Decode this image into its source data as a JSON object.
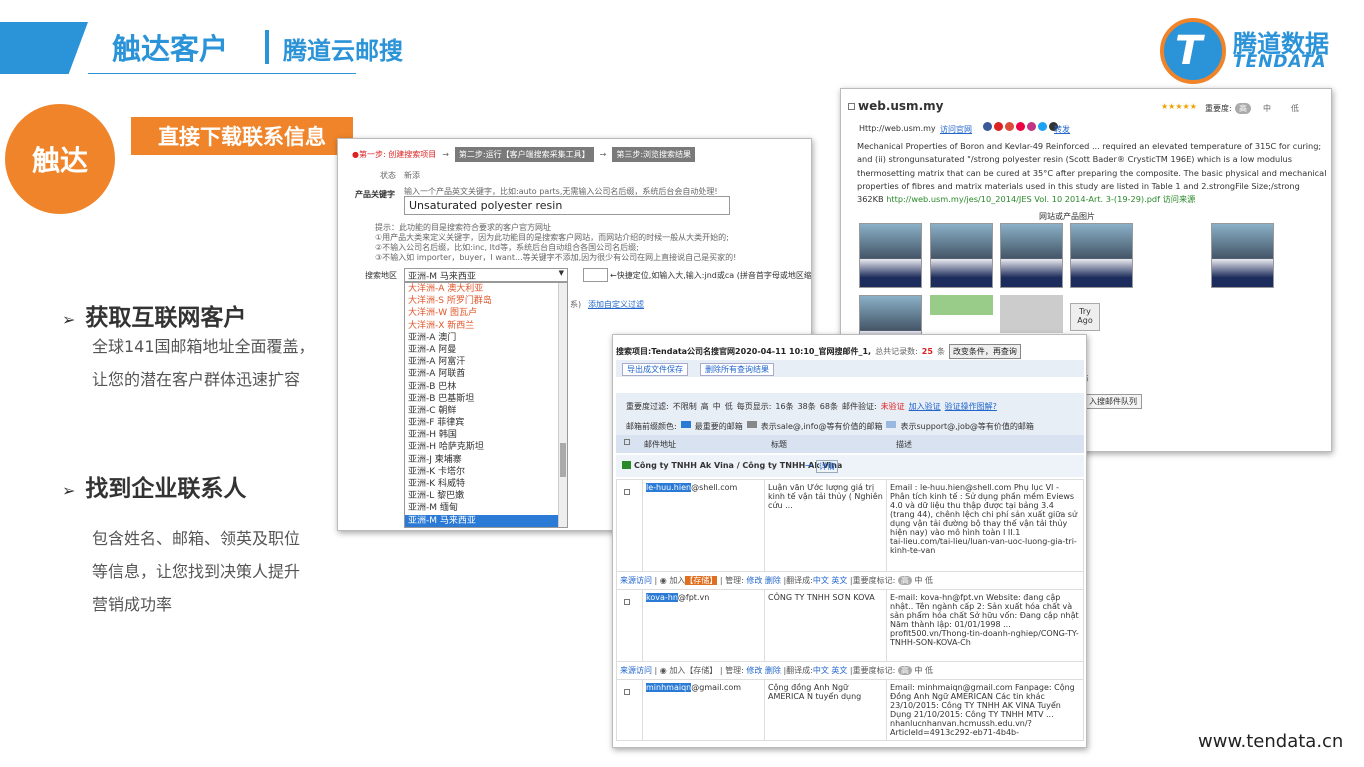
{
  "header": {
    "title": "触达客户",
    "separator": "|",
    "subtitle": "腾道云邮搜"
  },
  "logo": {
    "cn": "腾道数据",
    "en": "TENDATA"
  },
  "left": {
    "circle": "触达",
    "tag": "直接下载联系信息",
    "b1": "获取互联网客户",
    "d1": "全球141国邮箱地址全面覆盖， 让您的潜在客户群体迅速扩容",
    "b2": "找到企业联系人",
    "d2": "包含姓名、邮箱、领英及职位等信息，让您找到决策人提升营销成功率"
  },
  "footer_url": "www.tendata.cn",
  "search": {
    "step1": "●第一步: 创建搜索项目",
    "step2": "第二步:运行【客户端搜索采集工具】",
    "step3": "第三步:浏览搜索结果",
    "arrow": "→",
    "status_label": "状态",
    "status_value": "新添",
    "kw_label": "产品关键字",
    "kw_hint": "输入一个产品英文关键字，比如:auto parts,无需输入公司名后缀，系统后台会自动处理!",
    "kw_value": "Unsaturated polyester resin",
    "tips": [
      "提示：此功能的目是搜索符合要求的客户官方网址",
      "①用产品大类来定义关键字，因为此功能目的是搜索客户网站，而网站介绍的时候一般从大类开始的;",
      "②不输入公司名后缀，比如:inc, ltd等，系统后台自动组合各国公司名后缀;",
      "③不输入如 importer，buyer，I want...等关键字不添加,因为很少有公司在网上直接说自己是买家的!"
    ],
    "region_label": "搜索地区",
    "region_value": "亚洲-M 马来西亚",
    "locate_hint": "←快捷定位,如输入大,输入:jnd或ca (拼音首字母或地区缩写)",
    "add_custom": "添加自定义过滤",
    "addbefore": "系)",
    "options": [
      "大洋洲-A 澳大利亚",
      "大洋洲-S 所罗门群岛",
      "大洋洲-W 图瓦卢",
      "大洋洲-X 新西兰",
      "亚洲-A 澳门",
      "亚洲-A 阿曼",
      "亚洲-A 阿富汗",
      "亚洲-A 阿联酋",
      "亚洲-B 巴林",
      "亚洲-B 巴基斯坦",
      "亚洲-C 朝鲜",
      "亚洲-F 菲律宾",
      "亚洲-H 韩国",
      "亚洲-H 哈萨克斯坦",
      "亚洲-J 柬埔寨",
      "亚洲-K 卡塔尔",
      "亚洲-K 科威特",
      "亚洲-L 黎巴嫩",
      "亚洲-M 缅甸",
      "亚洲-M 马来西亚"
    ]
  },
  "web": {
    "domain": "web.usm.my",
    "importance": "重要度:",
    "imp_opts": [
      "高",
      "中",
      "低"
    ],
    "http": "Http://web.usm.my",
    "visit": "访问官网",
    "forward": "转发",
    "body": "Mechanical Properties of Boron and Kevlar-49 Reinforced ... required an elevated temperature of 315C for curing; and (ii) strongunsaturated \"/strong polyester resin (Scott Bader® CrysticTM 196E) which is a low modulus thermosetting matrix that can be cured at 35°C after preparing the composite. The basic physical and mechanical properties of fibres and matrix materials used in this study are listed in Table 1 and 2.strongFile Size;/strong 362KB",
    "link": "http://web.usm.my/jes/10_2014/JES Vol. 10 2014-Art. 3-(19-29).pdf 访问来源",
    "images_title": "网站或产品图片",
    "tryago": "Try Ago",
    "btn": "入搜邮件队列",
    "seg": "与"
  },
  "results": {
    "project": "搜索项目:Tendata公司名搜官网2020-04-11 10:10_官网搜邮件_1,",
    "total_label": "总共记录数:",
    "total": "25",
    "total_unit": "条",
    "change_btn": "改变条件，再查询",
    "export_btn": "导出成文件保存",
    "delete_btn": "删除所有查询结果",
    "filter_label": "重要度过滤:",
    "filter_opts": [
      "不限制",
      "高",
      "中",
      "低"
    ],
    "per_page": "每页显示:",
    "pp_opts": [
      "16条",
      "38条",
      "68条"
    ],
    "verify_label": "邮件验证:",
    "verify_status": "未验证",
    "add_verify": "加入验证",
    "verify_help": "验证操作图解?",
    "legend": "邮箱前缀颜色:",
    "leg1": "最重要的邮箱",
    "leg2": "表示sale@,info@等有价值的邮箱",
    "leg3": "表示support@,job@等有价值的邮箱",
    "cols": [
      "邮件地址",
      "标题",
      "描述"
    ],
    "company": "Công ty TNHH Ak Vina / Công ty TNHH Ak Vina",
    "details": "详情",
    "rows": [
      {
        "prefix": "le-huu.hien",
        "domain": "@shell.com",
        "title": "Luận văn Ước lượng giá trị kinh tế vận tải thủy ( Nghiên cứu ...",
        "desc": "Email : le-huu.hien@shell.com Phụ lục VI - Phân tích kinh tế : Sử dụng phần mềm Eviews 4.0 và dữ liệu thu thập được tại bảng 3.4 (trang 44), chênh lệch chi phí sản xuất giữa sử dụng vận tải đường bộ thay thế vận tải thủy hiện nay) vào mô hình toàn I II.1",
        "src": "tai-lieu.com/tai-lieu/luan-van-uoc-luong-gia-tri-kinh-te-van",
        "src2": "Rh-te-van"
      },
      {
        "prefix": "kova-hn",
        "domain": "@fpt.vn",
        "title": "CÔNG TY TNHH SƠN KOVA",
        "desc": "E-mail: kova-hn@fpt.vn Website: đang cập nhật.. Tên ngành cấp 2: Sản xuất hóa chất và sản phẩm hóa chất Sở hữu vốn: Đang cập nhật Năm thành lập: 01/01/1998 ...",
        "src": "profit500.vn/Thong-tin-doanh-nghiep/CONG-TY-TNHH-SON-KOVA-Ch",
        "src2": ""
      },
      {
        "prefix": "minhmaiqn",
        "domain": "@gmail.com",
        "title": "Cộng đồng Anh Ngữ AMERICA N tuyển dụng",
        "desc": "Email: minhmaiqn@gmail.com Fanpage: Cộng Đồng Anh Ngữ AMERICAN Các tin khác 23/10/2015: Công TY TNHH AK VINA Tuyển Dụng 21/10/2015: Công TY TNHH MTV ...",
        "src": "nhanlucnhanvan.hcmussh.edu.vn/?ArticleId=4913c292-eb71-4b4b-",
        "src2": ""
      }
    ],
    "actions": [
      "来源访问",
      "加入",
      "【存储】",
      "管理:",
      "修改",
      "删除",
      "|翻译成:",
      "中文",
      "英文",
      "|重要度标记:",
      "高",
      "中",
      "低"
    ]
  }
}
